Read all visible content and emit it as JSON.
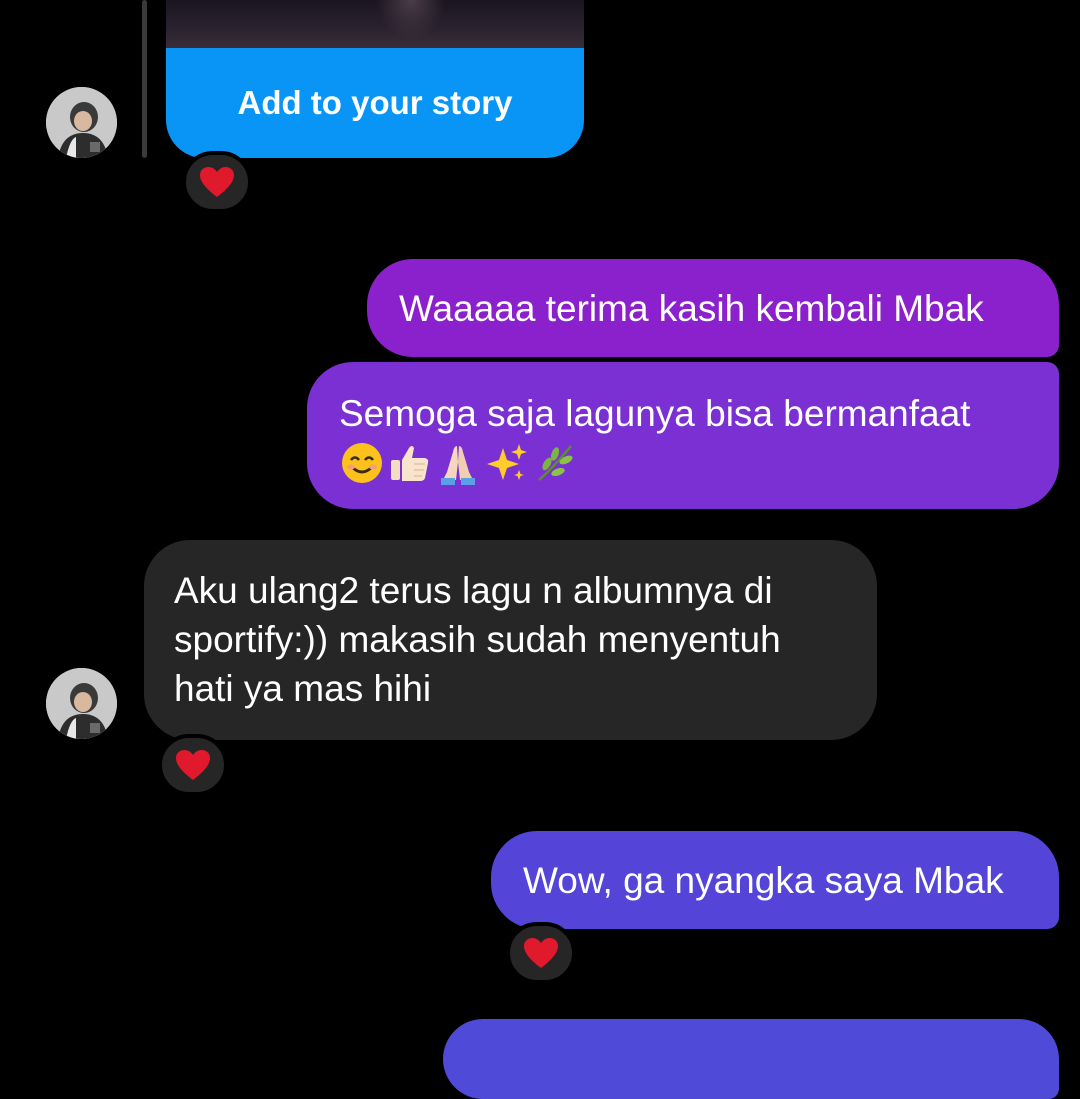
{
  "story_card": {
    "button_label": "Add to your story"
  },
  "messages": [
    {
      "text": "Waaaaa terima kasih kembali Mbak"
    },
    {
      "text": "Semoga saja lagunya bisa bermanfaat",
      "emojis": [
        "smiling-face",
        "thumbs-up",
        "folded-hands",
        "sparkles",
        "herb"
      ]
    },
    {
      "lines": [
        "Aku ulang2 terus lagu n albumnya di",
        "sportify:)) makasih sudah menyentuh",
        "hati ya mas hihi"
      ]
    },
    {
      "text": "Wow, ga nyangka saya Mbak"
    }
  ],
  "colors": {
    "background": "#000000",
    "story_button": "#0895f6",
    "outgoing_1": "#8b21cc",
    "outgoing_2": "#7b30d4",
    "outgoing_3": "#5444d8",
    "incoming": "#262626",
    "heart": "#e0192c"
  }
}
